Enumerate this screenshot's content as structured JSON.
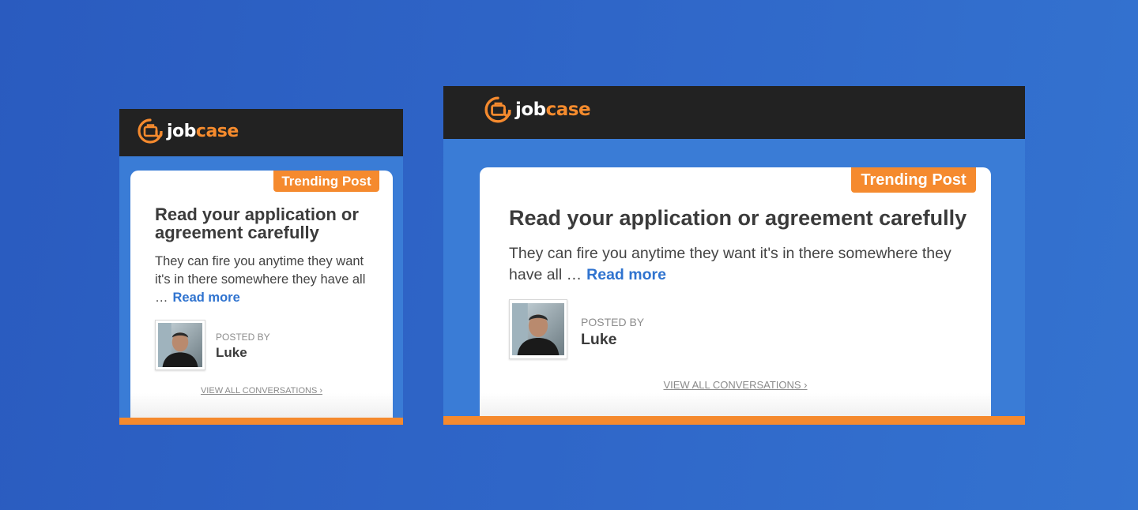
{
  "brand": {
    "logo_text_1": "job",
    "logo_text_2": "case",
    "accent_color": "#f58a2e",
    "header_color": "#222222",
    "background_color": "#3a7cd6"
  },
  "ads": {
    "small": {
      "badge": "Trending Post",
      "title": "Read your application or agreement carefully",
      "body": "They can fire you anytime they want it's in there somewhere they have all …",
      "read_more": "Read more",
      "posted_by_label": "POSTED BY",
      "author": "Luke",
      "view_all": "VIEW ALL CONVERSATIONS ›"
    },
    "large": {
      "badge": "Trending Post",
      "title": "Read your application or agreement carefully",
      "body": "They can fire you anytime they want it's in there somewhere they have all …",
      "read_more": "Read more",
      "posted_by_label": "POSTED BY",
      "author": "Luke",
      "view_all": "VIEW ALL CONVERSATIONS ›"
    }
  },
  "icons": {
    "logo": "briefcase-at-icon",
    "avatar": "user-avatar-photo"
  }
}
